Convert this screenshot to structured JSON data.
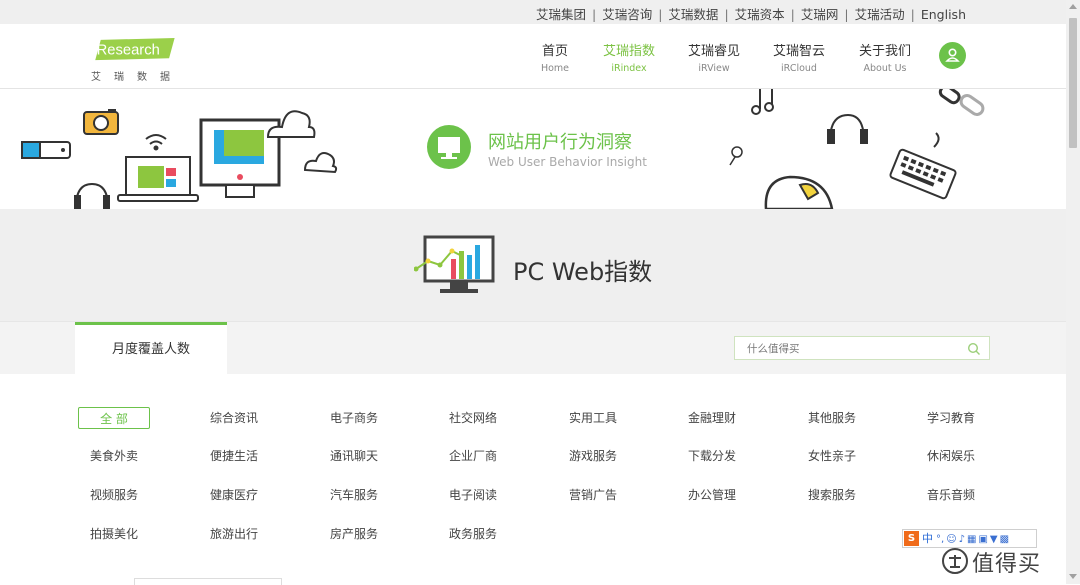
{
  "topbar": {
    "links": [
      "艾瑞集团",
      "艾瑞咨询",
      "艾瑞数据",
      "艾瑞资本",
      "艾瑞网",
      "艾瑞活动",
      "English"
    ]
  },
  "logo": {
    "word": "iResearch",
    "sub": "艾瑞数据"
  },
  "nav": [
    {
      "cn": "首页",
      "en": "Home",
      "active": false
    },
    {
      "cn": "艾瑞指数",
      "en": "iRindex",
      "active": true
    },
    {
      "cn": "艾瑞睿见",
      "en": "iRView",
      "active": false
    },
    {
      "cn": "艾瑞智云",
      "en": "iRCloud",
      "active": false
    },
    {
      "cn": "关于我们",
      "en": "About Us",
      "active": false
    }
  ],
  "user_icon": "user-icon",
  "banner": {
    "title": "网站用户行为洞察",
    "subtitle": "Web User Behavior Insight",
    "icon": "monitor-icon"
  },
  "page_title": "PC Web指数",
  "tabs": [
    {
      "label": "月度覆盖人数",
      "active": true
    }
  ],
  "search": {
    "placeholder": "什么值得买",
    "value": "",
    "icon": "search-icon"
  },
  "categories": [
    [
      "全 部",
      "综合资讯",
      "电子商务",
      "社交网络",
      "实用工具",
      "金融理财",
      "其他服务",
      "学习教育"
    ],
    [
      "美食外卖",
      "便捷生活",
      "通讯聊天",
      "企业厂商",
      "游戏服务",
      "下载分发",
      "女性亲子",
      "休闲娱乐"
    ],
    [
      "视频服务",
      "健康医疗",
      "汽车服务",
      "电子阅读",
      "营销广告",
      "办公管理",
      "搜索服务",
      "音乐音频"
    ],
    [
      "拍摄美化",
      "旅游出行",
      "房产服务",
      "政务服务"
    ]
  ],
  "active_category": "全 部",
  "ime_toolbar": {
    "logo": "S",
    "mode": "中"
  },
  "watermark": {
    "text": "值得买"
  },
  "colors": {
    "accent": "#6cc24a",
    "topbar_bg": "#efefef",
    "title_bg": "#efefef"
  }
}
